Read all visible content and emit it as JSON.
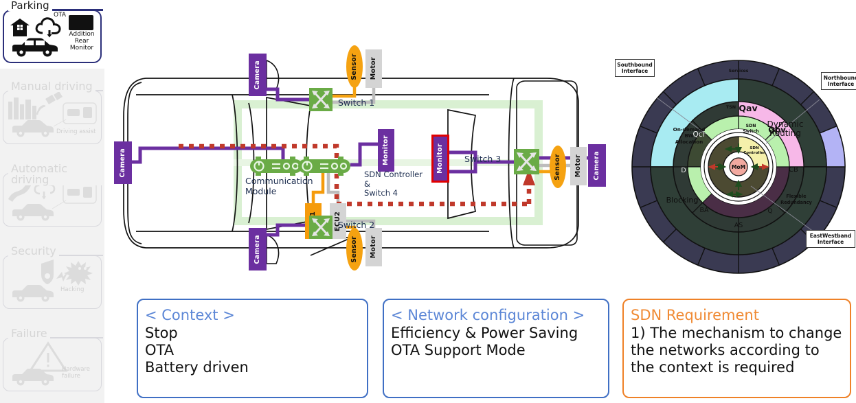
{
  "scenarios": [
    {
      "name": "parking",
      "label": "Parking",
      "active": true,
      "icons": [
        "house-icon",
        "cloud-ota-icon",
        "monitor-icon",
        "car-icon"
      ],
      "ota_label": "OTA",
      "monitor_label": "Addition\nRear\nMonitor"
    },
    {
      "name": "manual-driving",
      "label": "Manual driving",
      "active": false,
      "note": "Driving assist"
    },
    {
      "name": "automatic-driving",
      "label": "Automatic driving",
      "active": false,
      "note": ""
    },
    {
      "name": "security",
      "label": "Security",
      "active": false,
      "note": "Hacking"
    },
    {
      "name": "failure",
      "label": "Failure",
      "active": false,
      "note": "Hardware\nfailure"
    }
  ],
  "vehicle": {
    "switches": [
      {
        "name": "switch-1",
        "label": "Switch 1"
      },
      {
        "name": "switch-2",
        "label": "Switch 2"
      },
      {
        "name": "switch-3",
        "label": "Switch 3"
      }
    ],
    "controller_label": "SDN Controller\n&\nSwitch 4",
    "comm_module_label": "Communication\nModule",
    "nodes": {
      "camera": "Camera",
      "monitor": "Monitor",
      "sensor": "Sensor",
      "motor": "Motor",
      "ecu1": "ECU1",
      "ecu2": "ECU2"
    },
    "colors": {
      "camera": "#6b2fa0",
      "sensor": "#f5a211",
      "motor": "#d4d4d4",
      "switch": "#6aab46",
      "ecu1": "#f59b0b",
      "alert": "#e10000",
      "active_path": "#d9f0d2",
      "control_path": "#c0392b"
    }
  },
  "radial": {
    "center": "MoM",
    "ring_inner": [
      "SDN\nController"
    ],
    "ring_2": [
      "SDN\nSwitch"
    ],
    "ring_3": [
      "TSN",
      "Qav",
      "Qbv",
      "CB",
      "Q",
      "AS",
      "BA",
      "D",
      "Qci"
    ],
    "ring_4": [
      "On-demand\nBW\nAllocation",
      "Dynamic\nRouting",
      "Flexible\nRedundancy",
      "Blocking"
    ],
    "ring_outer": [
      "Services"
    ],
    "interfaces": [
      {
        "name": "southbound-interface",
        "label": "Southbound\nInterface"
      },
      {
        "name": "northbound-interface",
        "label": "Northbound\nInterface"
      },
      {
        "name": "eastwestband-interface",
        "label": "EastWestband\nInterface"
      }
    ],
    "colors": {
      "cyan": "#a8ebf2",
      "pink": "#f7b8e8",
      "lightgreen": "#b9f0ad",
      "yellow": "#f5f0ab",
      "lavender": "#b3b3f5",
      "rose": "#f2a9a0",
      "dark": "#2f3045",
      "plum": "#4a2e46",
      "olive": "#4c4a32"
    }
  },
  "info_boxes": [
    {
      "name": "context-box",
      "style": "blue",
      "heading": "< Context >",
      "lines": [
        "Stop",
        "OTA",
        "Battery driven"
      ]
    },
    {
      "name": "network-configuration-box",
      "style": "blue",
      "heading": "< Network configuration >",
      "lines": [
        "Efficiency & Power Saving",
        "OTA Support Mode"
      ]
    },
    {
      "name": "sdn-requirement-box",
      "style": "orange",
      "heading": "SDN Requirement",
      "lines": [
        "1) The mechanism to change",
        "the networks according to",
        "the context is required"
      ]
    }
  ]
}
